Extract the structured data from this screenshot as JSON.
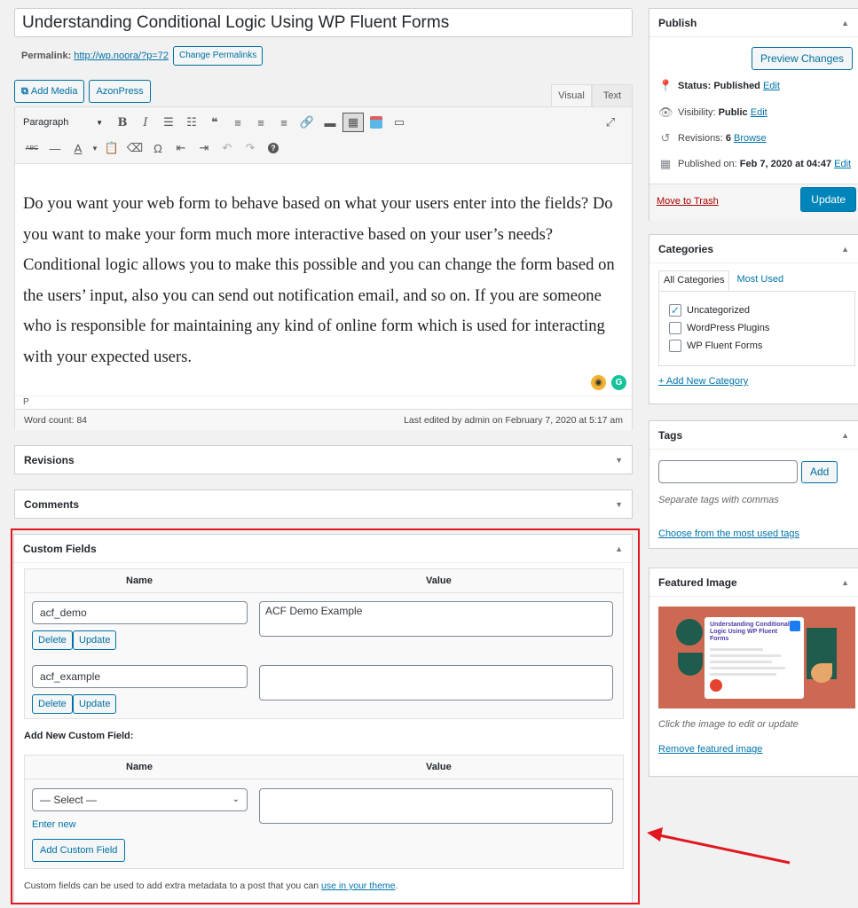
{
  "title": "Understanding Conditional Logic Using WP Fluent Forms",
  "permalink": {
    "label": "Permalink:",
    "url": "http://wp.noora/?p=72",
    "change_label": "Change Permalinks"
  },
  "media_buttons": {
    "add_media": "Add Media",
    "azonpress": "AzonPress"
  },
  "editor_tabs": {
    "visual": "Visual",
    "text": "Text"
  },
  "toolbar": {
    "format_select": "Paragraph"
  },
  "content": "Do you want your web form to behave based on what your users enter into the fields? Do you want to make your form much more interactive based on your user’s needs? Conditional logic allows you to make this possible and you can change the form based on the users’ input, also you can send out notification email, and so on. If you are someone who is responsible for maintaining any kind of online form which is used for interacting with your expected users.",
  "editor_path": "P",
  "word_count": "Word count: 84",
  "last_edited": "Last edited by admin on February 7, 2020 at 5:17 am",
  "boxes": {
    "revisions": "Revisions",
    "comments": "Comments",
    "custom_fields": "Custom Fields"
  },
  "custom_fields": {
    "col_name": "Name",
    "col_value": "Value",
    "rows": [
      {
        "name": "acf_demo",
        "value": "ACF Demo Example"
      },
      {
        "name": "acf_example",
        "value": ""
      }
    ],
    "delete_label": "Delete",
    "update_label": "Update",
    "add_new_label": "Add New Custom Field:",
    "select_value": "— Select —",
    "enter_new": "Enter new",
    "add_button": "Add Custom Field",
    "note_prefix": "Custom fields can be used to add extra metadata to a post that you can",
    "note_link": "use in your theme",
    "note_suffix": "."
  },
  "publish": {
    "title": "Publish",
    "preview": "Preview Changes",
    "status_label": "Status:",
    "status_value": "Published",
    "visibility_label": "Visibility:",
    "visibility_value": "Public",
    "revisions_label": "Revisions:",
    "revisions_value": "6",
    "browse": "Browse",
    "published_label": "Published on:",
    "published_value": "Feb 7, 2020 at 04:47",
    "edit": "Edit",
    "trash": "Move to Trash",
    "update": "Update"
  },
  "categories": {
    "title": "Categories",
    "tab_all": "All Categories",
    "tab_used": "Most Used",
    "items": [
      {
        "label": "Uncategorized",
        "checked": true
      },
      {
        "label": "WordPress Plugins",
        "checked": false
      },
      {
        "label": "WP Fluent Forms",
        "checked": false
      }
    ],
    "add_new": "+ Add New Category"
  },
  "tags": {
    "title": "Tags",
    "add": "Add",
    "hint": "Separate tags with commas",
    "choose": "Choose from the most used tags"
  },
  "featured": {
    "title": "Featured Image",
    "thumb_title": "Understanding Conditional Logic Using WP Fluent Forms",
    "hint": "Click the image to edit or update",
    "remove": "Remove featured image"
  },
  "colors": {
    "accent": "#0073aa",
    "primary_button": "#0085ba",
    "highlight": "#e1161f",
    "thumb_bg": "#cd6952"
  }
}
